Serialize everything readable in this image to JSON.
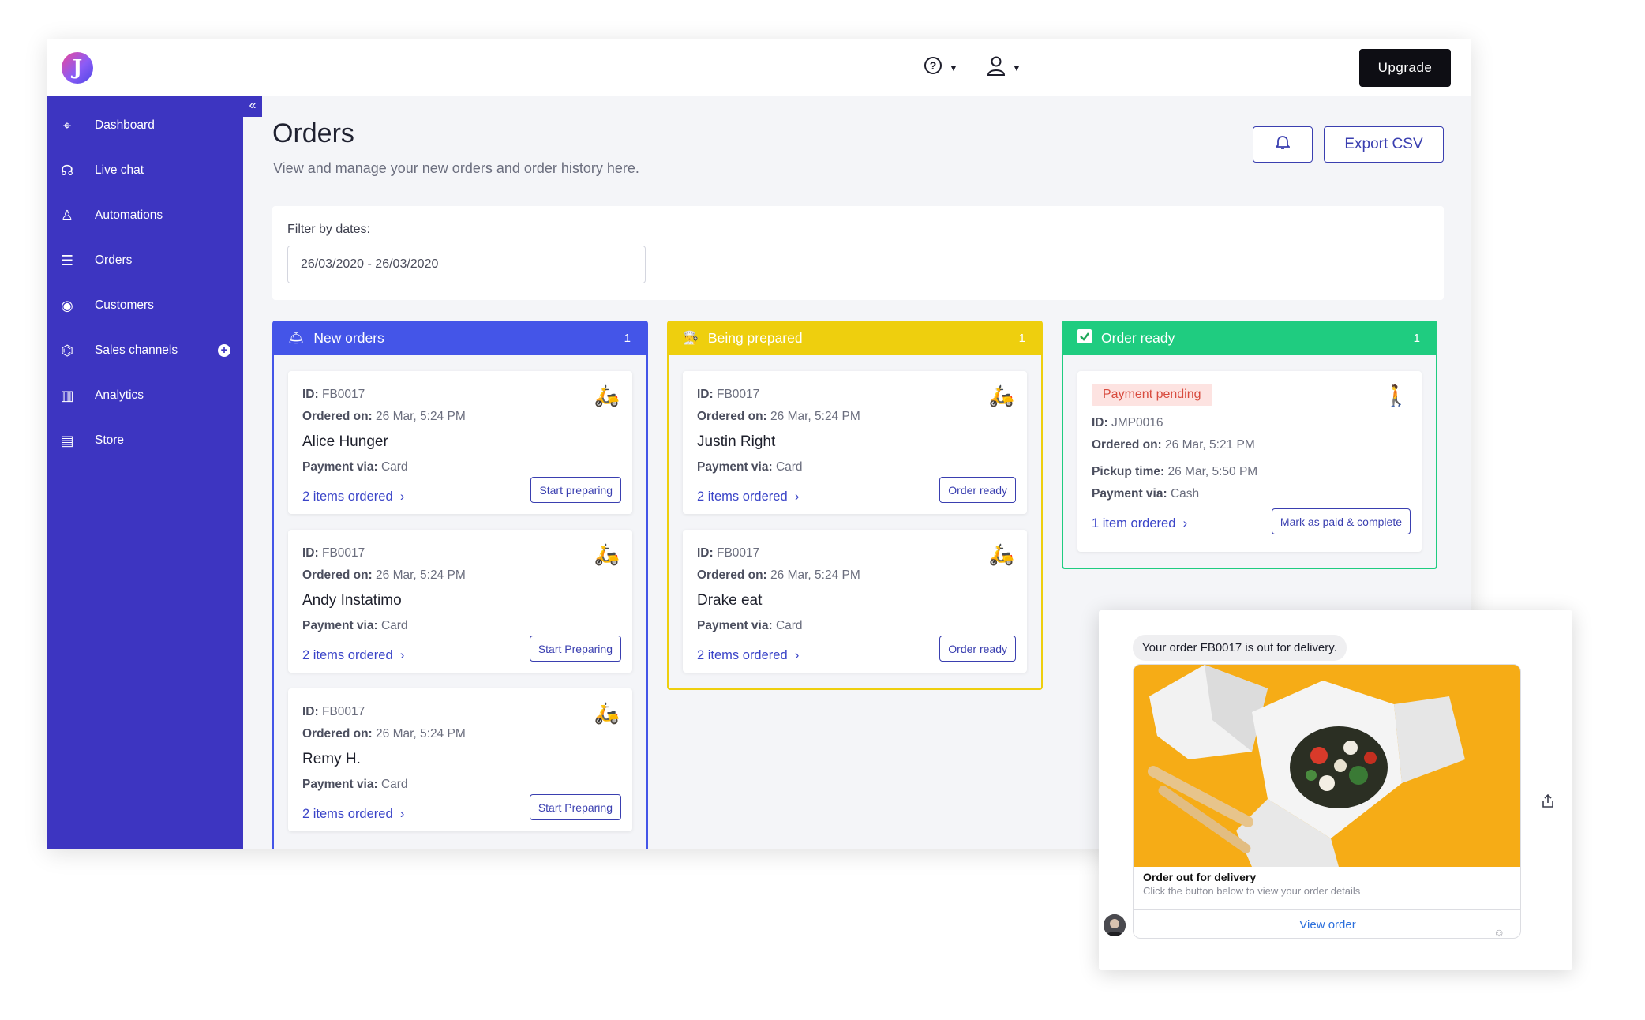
{
  "header": {
    "logo_letter": "J",
    "help_icon": "help-circle-icon",
    "user_icon": "user-icon",
    "upgrade_label": "Upgrade"
  },
  "sidebar": {
    "collapse_glyph": "«",
    "items": [
      {
        "label": "Dashboard",
        "icon": "speedometer-icon"
      },
      {
        "label": "Live chat",
        "icon": "headset-icon"
      },
      {
        "label": "Automations",
        "icon": "robot-icon"
      },
      {
        "label": "Orders",
        "icon": "clipboard-icon"
      },
      {
        "label": "Customers",
        "icon": "user-circle-icon"
      },
      {
        "label": "Sales channels",
        "icon": "channels-icon"
      },
      {
        "label": "Analytics",
        "icon": "analytics-icon"
      },
      {
        "label": "Store",
        "icon": "store-icon"
      }
    ]
  },
  "page": {
    "title": "Orders",
    "subtitle": "View and manage your new orders and order history here.",
    "export_label": "Export CSV"
  },
  "filter": {
    "label": "Filter by dates:",
    "value": "26/03/2020 - 26/03/2020"
  },
  "columns": [
    {
      "title": "New orders",
      "count": "1",
      "color": "#4455e8",
      "orders": [
        {
          "id": "FB0017",
          "ordered": "26 Mar, 5:24 PM",
          "name": "Alice Hunger",
          "payment": "Card",
          "items": "2 items ordered",
          "action": "Start preparing"
        },
        {
          "id": "FB0017",
          "ordered": "26 Mar, 5:24 PM",
          "name": "Andy Instatimo",
          "payment": "Card",
          "items": "2 items ordered",
          "action": "Start Preparing"
        },
        {
          "id": "FB0017",
          "ordered": "26 Mar, 5:24 PM",
          "name": "Remy H.",
          "payment": "Card",
          "items": "2 items ordered",
          "action": "Start Preparing"
        }
      ]
    },
    {
      "title": "Being prepared",
      "count": "1",
      "color": "#eecf0e",
      "orders": [
        {
          "id": "FB0017",
          "ordered": "26 Mar, 5:24 PM",
          "name": "Justin Right",
          "payment": "Card",
          "items": "2 items ordered",
          "action": "Order ready"
        },
        {
          "id": "FB0017",
          "ordered": "26 Mar, 5:24 PM",
          "name": "Drake eat",
          "payment": "Card",
          "items": "2 items ordered",
          "action": "Order ready"
        }
      ]
    },
    {
      "title": "Order ready",
      "count": "1",
      "color": "#1fcc80",
      "orders": [
        {
          "badge": "Payment pending",
          "id": "JMP0016",
          "ordered": "26 Mar, 5:21 PM",
          "pickup": "26 Mar, 5:50 PM",
          "payment": "Cash",
          "items": "1 item ordered",
          "action": "Mark as paid & complete"
        }
      ]
    }
  ],
  "labels": {
    "id": "ID:",
    "ordered_on": "Ordered on:",
    "payment_via": "Payment via:",
    "pickup_time": "Pickup time:"
  },
  "chat": {
    "message": "Your order FB0017 is out for delivery.",
    "card_title": "Order out for delivery",
    "card_subtitle": "Click the button below to view your order details",
    "button_label": "View order"
  }
}
